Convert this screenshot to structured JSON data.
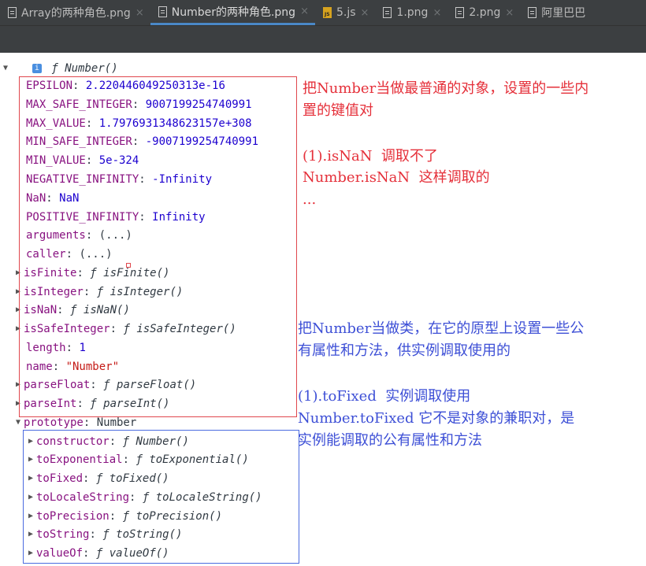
{
  "tabs": [
    {
      "label": "Array的两种角色.png",
      "icon": "image-file-icon",
      "active": false
    },
    {
      "label": "Number的两种角色.png",
      "icon": "image-file-icon",
      "active": true
    },
    {
      "label": "5.js",
      "icon": "js-file-icon",
      "active": false
    },
    {
      "label": "1.png",
      "icon": "image-file-icon",
      "active": false
    },
    {
      "label": "2.png",
      "icon": "image-file-icon",
      "active": false
    },
    {
      "label": "阿里巴巴",
      "icon": "image-file-icon",
      "active": false
    }
  ],
  "close_glyph": "×",
  "console": {
    "header_fn": "ƒ",
    "header_name": "Number()",
    "props": [
      {
        "key": "EPSILON",
        "value": "2.220446049250313e-16"
      },
      {
        "key": "MAX_SAFE_INTEGER",
        "value": "9007199254740991"
      },
      {
        "key": "MAX_VALUE",
        "value": "1.7976931348623157e+308"
      },
      {
        "key": "MIN_SAFE_INTEGER",
        "value": "-9007199254740991"
      },
      {
        "key": "MIN_VALUE",
        "value": "5e-324"
      },
      {
        "key": "NEGATIVE_INFINITY",
        "value": "-Infinity"
      },
      {
        "key": "NaN",
        "value": "NaN"
      },
      {
        "key": "POSITIVE_INFINITY",
        "value": "Infinity"
      },
      {
        "key": "arguments",
        "value": "(...)"
      },
      {
        "key": "caller",
        "value": "(...)"
      },
      {
        "key": "isFinite",
        "value": "isFinite()"
      },
      {
        "key": "isInteger",
        "value": "isInteger()"
      },
      {
        "key": "isNaN",
        "value": "isNaN()"
      },
      {
        "key": "isSafeInteger",
        "value": "isSafeInteger()"
      },
      {
        "key": "length",
        "value": "1"
      },
      {
        "key": "name",
        "value": "\"Number\""
      },
      {
        "key": "parseFloat",
        "value": "parseFloat()"
      },
      {
        "key": "parseInt",
        "value": "parseInt()"
      },
      {
        "key": "prototype",
        "value": "Number"
      }
    ],
    "proto": [
      {
        "key": "constructor",
        "value": "Number()"
      },
      {
        "key": "toExponential",
        "value": "toExponential()"
      },
      {
        "key": "toFixed",
        "value": "toFixed()"
      },
      {
        "key": "toLocaleString",
        "value": "toLocaleString()"
      },
      {
        "key": "toPrecision",
        "value": "toPrecision()"
      },
      {
        "key": "toString",
        "value": "toString()"
      },
      {
        "key": "valueOf",
        "value": "valueOf()"
      }
    ]
  },
  "notes": {
    "red": {
      "line1": "把Number当做最普通的对象，设置的一些内",
      "line2": "置的键值对",
      "line3": "(1).isNaN  调取不了",
      "line4": "Number.isNaN  这样调取的",
      "line5": "..."
    },
    "blue": {
      "line1": "把Number当做类，在它的原型上设置一些公",
      "line2": "有属性和方法，供实例调取使用的",
      "line3": "(1).toFixed  实例调取使用",
      "line4": "Number.toFixed 它不是对象的兼职对，是",
      "line5": "实例能调取的公有属性和方法"
    }
  },
  "colors": {
    "annotation_red": "#e5303a",
    "annotation_blue": "#3d4fd6",
    "tab_active_underline": "#4a88c7"
  }
}
